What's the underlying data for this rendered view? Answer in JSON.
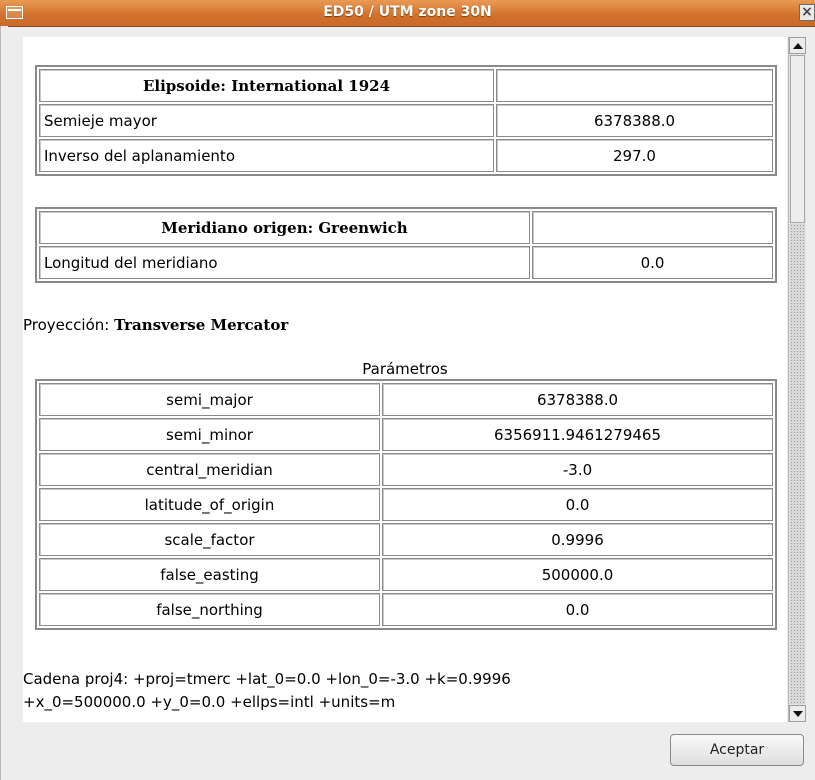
{
  "window": {
    "title": "ED50 / UTM zone 30N",
    "close_glyph": "×"
  },
  "ellipsoid": {
    "header": "Elipsoide: International 1924",
    "rows": [
      {
        "label": "Semieje mayor",
        "value": "6378388.0"
      },
      {
        "label": "Inverso del aplanamiento",
        "value": "297.0"
      }
    ]
  },
  "meridian": {
    "header": "Meridiano origen: Greenwich",
    "rows": [
      {
        "label": "Longitud del meridiano",
        "value": "0.0"
      }
    ]
  },
  "projection": {
    "label": "Proyección: ",
    "name": "Transverse Mercator"
  },
  "parameters": {
    "title": "Parámetros",
    "rows": [
      {
        "name": "semi_major",
        "value": "6378388.0"
      },
      {
        "name": "semi_minor",
        "value": "6356911.9461279465"
      },
      {
        "name": "central_meridian",
        "value": "-3.0"
      },
      {
        "name": "latitude_of_origin",
        "value": "0.0"
      },
      {
        "name": "scale_factor",
        "value": "0.9996"
      },
      {
        "name": "false_easting",
        "value": "500000.0"
      },
      {
        "name": "false_northing",
        "value": "0.0"
      }
    ]
  },
  "proj4": {
    "line1": "Cadena proj4: +proj=tmerc +lat_0=0.0 +lon_0=-3.0 +k=0.9996",
    "line2": "+x_0=500000.0 +y_0=0.0 +ellps=intl +units=m"
  },
  "buttons": {
    "accept": "Aceptar"
  },
  "icons": {
    "window_menu": "window-menu-icon",
    "close": "close-icon",
    "scroll_up": "scroll-up-arrow-icon",
    "scroll_down": "scroll-down-arrow-icon"
  },
  "colors": {
    "titlebar": "#d4732c",
    "border": "#8a8a8a",
    "background": "#ededed"
  }
}
